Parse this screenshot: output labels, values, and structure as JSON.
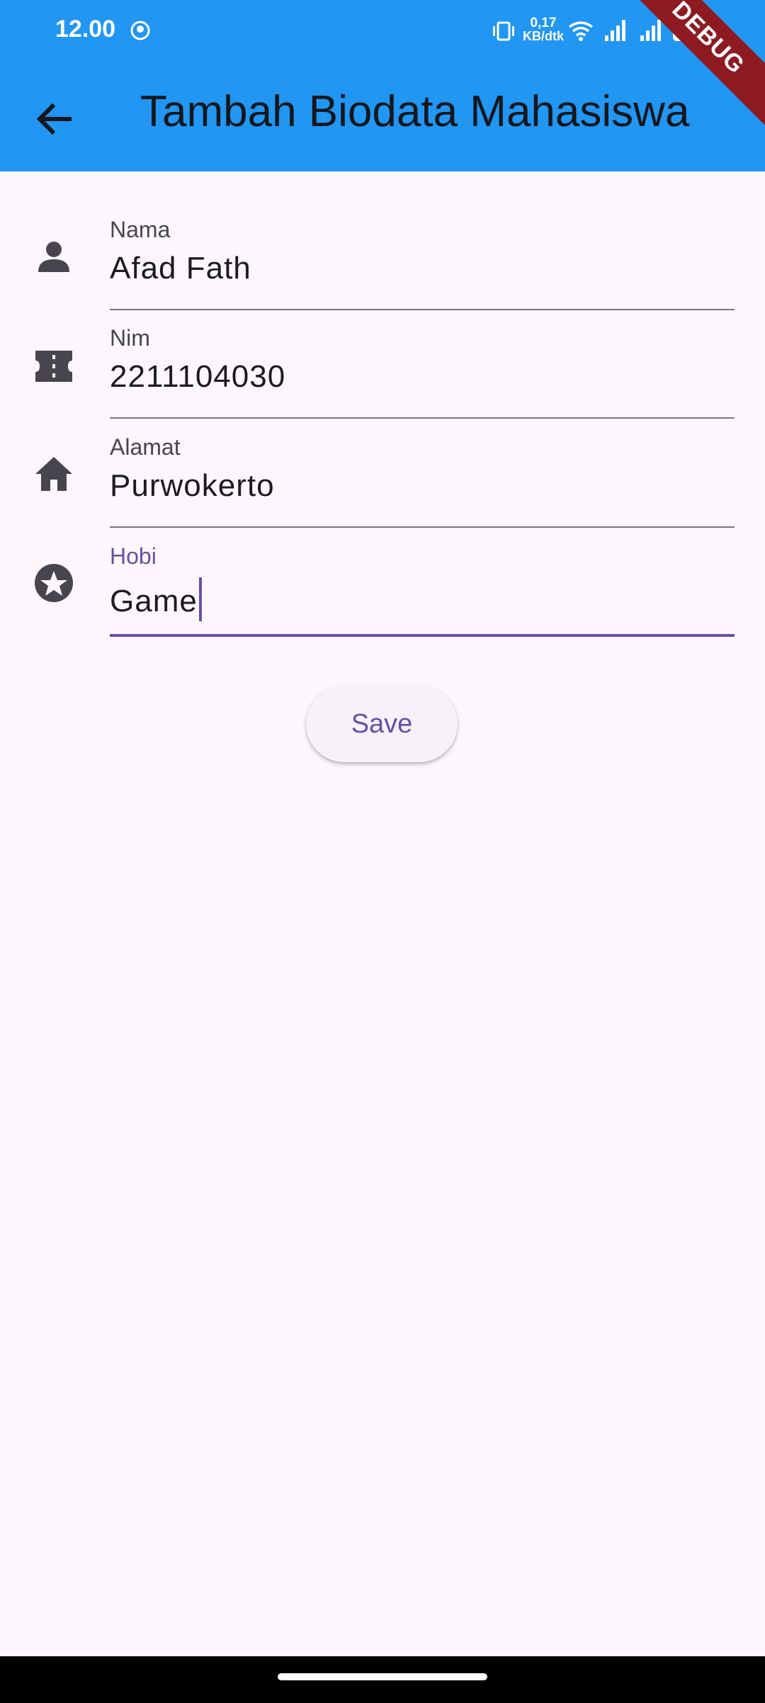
{
  "status_bar": {
    "time": "12.00",
    "net_speed_value": "0,17",
    "net_speed_unit": "KB/dtk",
    "battery": "100",
    "debug_banner": "DEBUG"
  },
  "app_bar": {
    "title": "Tambah Biodata Mahasiswa",
    "background_color": "#2196F3"
  },
  "form": {
    "fields": [
      {
        "label": "Nama",
        "value": "Afad Fath",
        "icon": "person-icon"
      },
      {
        "label": "Nim",
        "value": "2211104030",
        "icon": "badge-icon"
      },
      {
        "label": "Alamat",
        "value": "Purwokerto",
        "icon": "home-icon"
      },
      {
        "label": "Hobi",
        "value": "Game",
        "icon": "star-circle-icon",
        "focused": true
      }
    ],
    "save_label": "Save"
  },
  "colors": {
    "accent": "#6750A4",
    "background": "#FDF7FD",
    "debug_banner": "#8E1A22"
  }
}
